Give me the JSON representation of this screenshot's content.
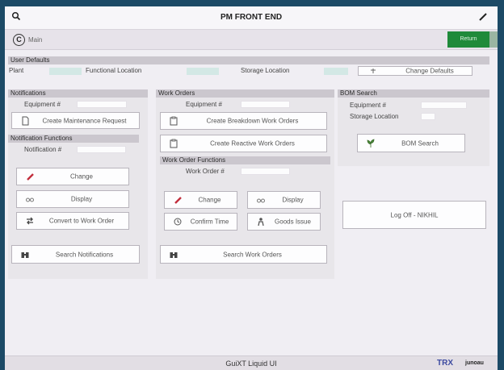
{
  "header": {
    "title": "PM FRONT END"
  },
  "nav": {
    "main_letter": "C",
    "main_label": "Main",
    "return_label": "Return"
  },
  "user_defaults": {
    "section": "User Defaults",
    "plant_label": "Plant",
    "functional_location_label": "Functional Location",
    "storage_location_label": "Storage Location",
    "change_defaults_label": "Change Defaults"
  },
  "notifications": {
    "section": "Notifications",
    "equipment_label": "Equipment #",
    "create_maintenance_label": "Create Maintenance Request",
    "functions_section": "Notification Functions",
    "notification_label": "Notification #",
    "change_label": "Change",
    "display_label": "Display",
    "convert_label": "Convert to Work Order",
    "search_label": "Search Notifications"
  },
  "work_orders": {
    "section": "Work Orders",
    "equipment_label": "Equipment #",
    "create_breakdown_label": "Create Breakdown Work Orders",
    "create_reactive_label": "Create Reactive Work Orders",
    "functions_section": "Work Order Functions",
    "work_order_label": "Work Order #",
    "change_label": "Change",
    "display_label": "Display",
    "confirm_time_label": "Confirm Time",
    "goods_issue_label": "Goods Issue",
    "search_label": "Search Work Orders"
  },
  "bom": {
    "section": "BOM Search",
    "equipment_label": "Equipment #",
    "storage_location_label": "Storage Location",
    "search_label": "BOM Search"
  },
  "logoff": {
    "label": "Log Off - NIKHIL"
  },
  "footer": {
    "title": "GuiXT Liquid UI",
    "brand": "TRX",
    "brand2": "junoau"
  }
}
